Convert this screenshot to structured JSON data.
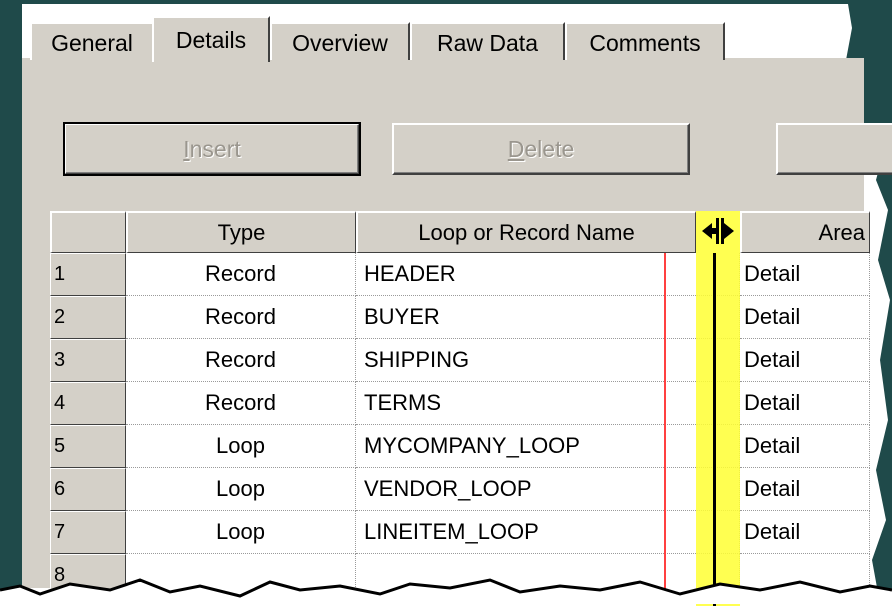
{
  "tabs": [
    {
      "label": "General"
    },
    {
      "label": "Details"
    },
    {
      "label": "Overview"
    },
    {
      "label": "Raw Data"
    },
    {
      "label": "Comments"
    }
  ],
  "buttons": {
    "insert": {
      "mnemonic": "I",
      "rest": "nsert"
    },
    "delete": {
      "mnemonic": "D",
      "rest": "elete"
    }
  },
  "grid": {
    "headers": {
      "type": "Type",
      "name": "Loop or Record Name",
      "area": "Area"
    },
    "rows": [
      {
        "num": "1",
        "type": "Record",
        "name": "HEADER",
        "area": "Detail"
      },
      {
        "num": "2",
        "type": "Record",
        "name": "BUYER",
        "area": "Detail"
      },
      {
        "num": "3",
        "type": "Record",
        "name": "SHIPPING",
        "area": "Detail"
      },
      {
        "num": "4",
        "type": "Record",
        "name": "TERMS",
        "area": "Detail"
      },
      {
        "num": "5",
        "type": "Loop",
        "name": "MYCOMPANY_LOOP",
        "area": "Detail"
      },
      {
        "num": "6",
        "type": "Loop",
        "name": "VENDOR_LOOP",
        "area": "Detail"
      },
      {
        "num": "7",
        "type": "Loop",
        "name": "LINEITEM_LOOP",
        "area": "Detail"
      },
      {
        "num": "8",
        "type": "",
        "name": "",
        "area": ""
      }
    ]
  },
  "colors": {
    "frame": "#1f4a4a",
    "face": "#d4d0c8",
    "highlight": "#ffff33",
    "marker": "#ff4040"
  },
  "icons": {
    "cursor": "column-resize-cursor-icon"
  }
}
